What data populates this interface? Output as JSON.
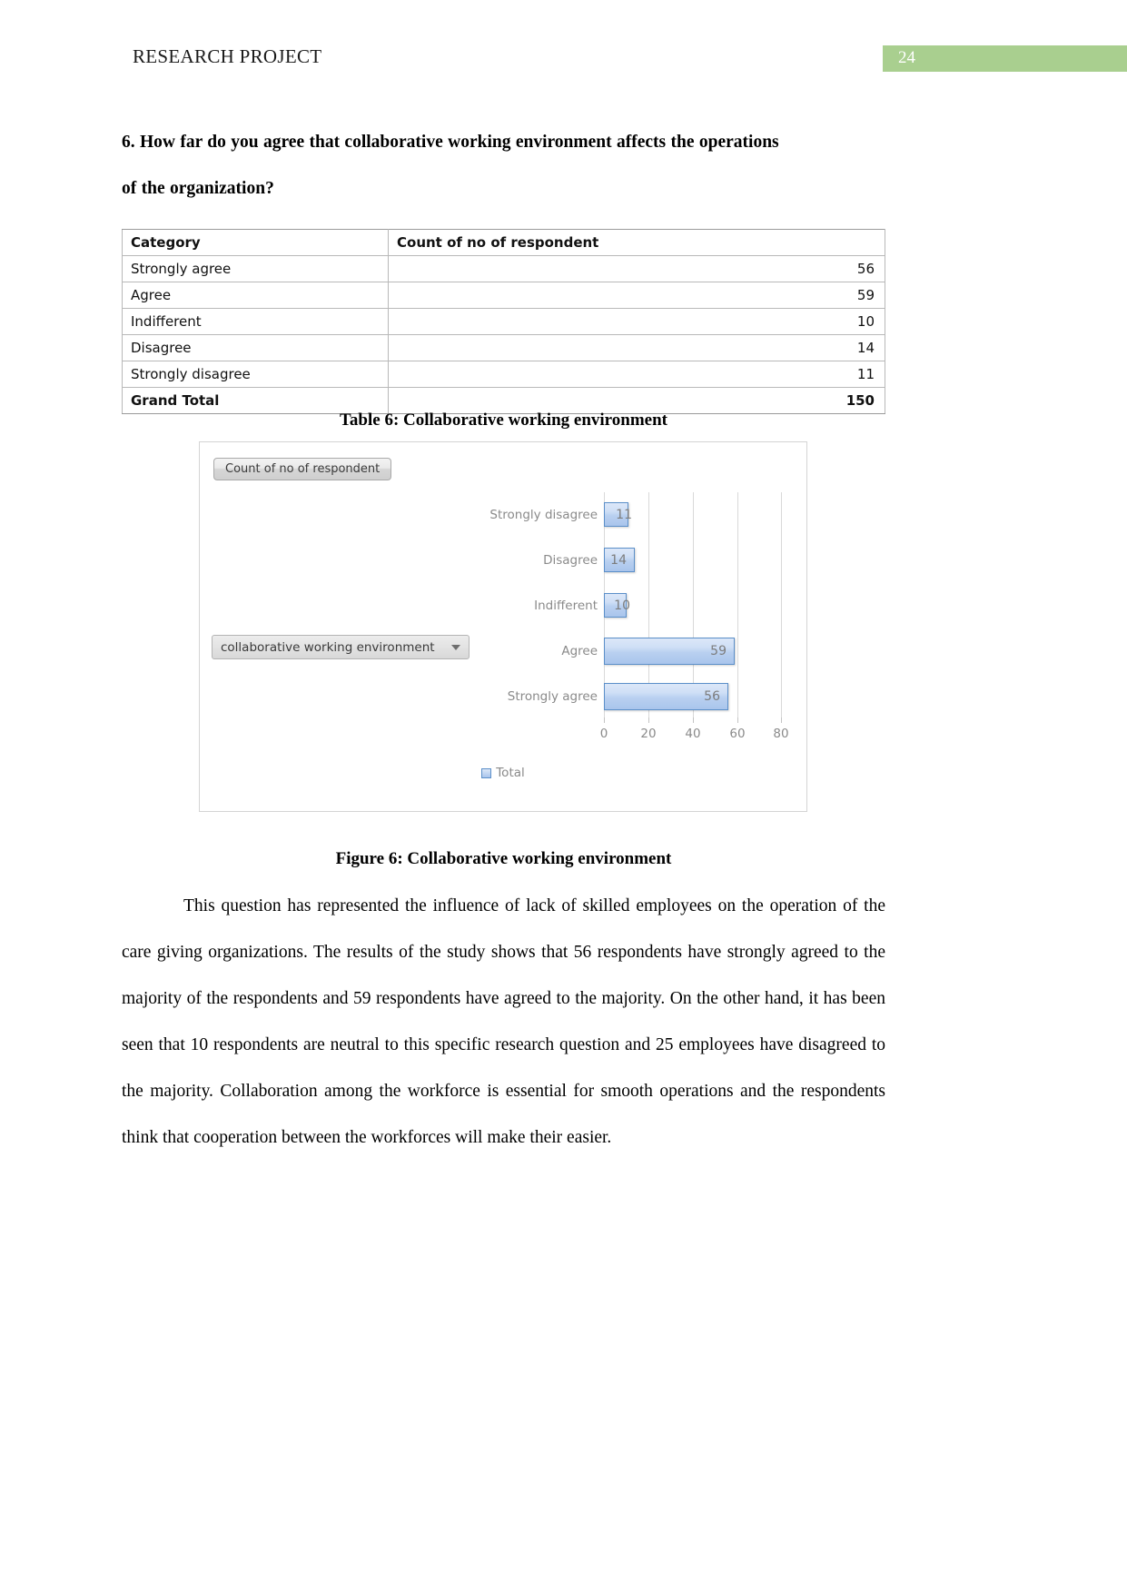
{
  "header": {
    "running_title": "RESEARCH PROJECT",
    "page_number": "24",
    "badge_color": "#a9cf8f"
  },
  "question": {
    "line1": "6. How far do you agree that collaborative working environment affects the operations",
    "line2": "of the organization?"
  },
  "table": {
    "headers": [
      "Category",
      "Count of no of respondent"
    ],
    "rows": [
      {
        "category": "Strongly agree",
        "count": "56"
      },
      {
        "category": "Agree",
        "count": "59"
      },
      {
        "category": "Indifferent",
        "count": "10"
      },
      {
        "category": "Disagree",
        "count": "14"
      },
      {
        "category": "Strongly disagree",
        "count": "11"
      }
    ],
    "total": {
      "category": "Grand Total",
      "count": "150"
    },
    "caption": "Table 6: Collaborative working environment"
  },
  "chart": {
    "field_button_label": "Count of no of respondent",
    "slicer_label": "collaborative working environment",
    "legend_label": "Total",
    "caption": "Figure 6: Collaborative working environment"
  },
  "chart_data": {
    "type": "bar",
    "orientation": "horizontal",
    "title": "",
    "subtitle": "",
    "categories": [
      "Strongly disagree",
      "Disagree",
      "Indifferent",
      "Agree",
      "Strongly agree"
    ],
    "values": [
      11,
      14,
      10,
      59,
      56
    ],
    "data_labels": [
      "11",
      "14",
      "10",
      "59",
      "56"
    ],
    "series": [
      {
        "name": "Total",
        "values": [
          11,
          14,
          10,
          59,
          56
        ]
      }
    ],
    "xlabel": "",
    "ylabel": "",
    "xlim": [
      0,
      80
    ],
    "xticks": [
      0,
      20,
      40,
      60,
      80
    ],
    "xtick_labels": [
      "0",
      "20",
      "40",
      "60",
      "80"
    ],
    "grid": "vertical",
    "legend_position": "bottom",
    "bar_fill": "#c3d8f2",
    "bar_border": "#5b8fc9",
    "label_color": "#8a8a8a"
  },
  "body": {
    "paragraph": "This question has represented the influence of lack of skilled employees on the operation of the care giving organizations. The results of the study shows that 56 respondents have strongly agreed to the majority of the respondents and 59 respondents have agreed to the majority. On the other hand, it has been seen that 10 respondents are neutral to this specific research question and 25 employees have disagreed to the majority. Collaboration among the workforce is essential for smooth operations and the respondents think that cooperation between the workforces will make their easier."
  }
}
